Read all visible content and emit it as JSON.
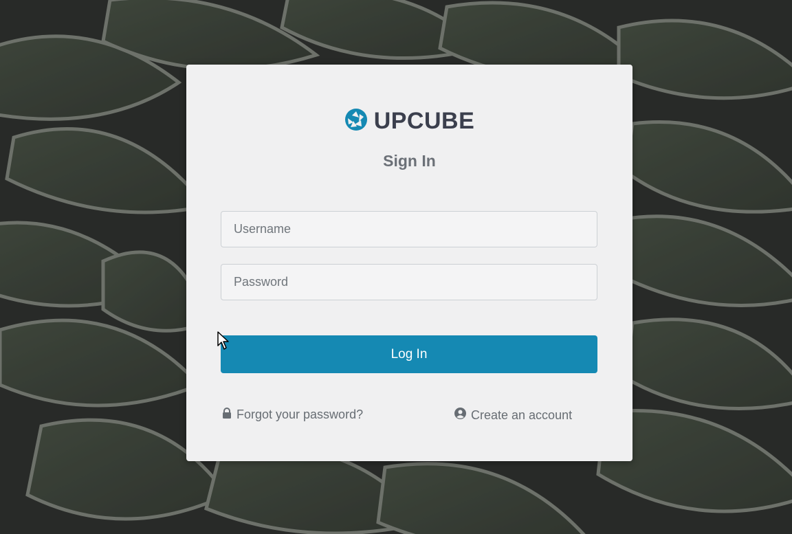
{
  "brand": {
    "name": "UPCUBE",
    "logo_icon": "aperture-icon",
    "accent_color": "#1589b3"
  },
  "form": {
    "title": "Sign In",
    "username_placeholder": "Username",
    "password_placeholder": "Password",
    "username_value": "",
    "password_value": "",
    "login_label": "Log In"
  },
  "links": {
    "forgot_label": "Forgot your password?",
    "forgot_icon": "lock-icon",
    "create_label": "Create an account",
    "create_icon": "user-circle-icon"
  },
  "background": {
    "description_icon": "leaf-background"
  }
}
